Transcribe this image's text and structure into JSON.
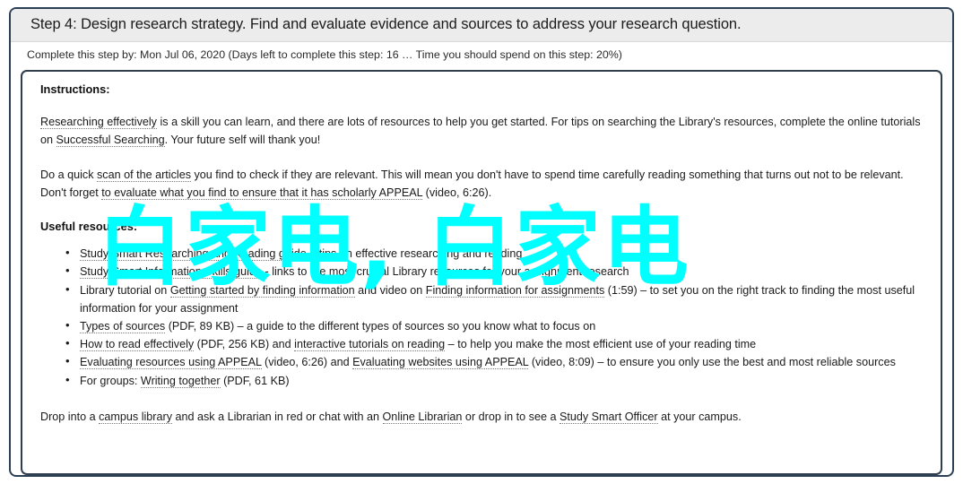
{
  "step": {
    "header": "Step 4: Design research strategy. Find and evaluate evidence and sources to address your research question.",
    "subline": "Complete this step by: Mon Jul 06, 2020 (Days left to complete this step: 16 … Time you should spend on this step: 20%)",
    "due_date": "Mon Jul 06, 2020",
    "days_left": "16",
    "time_percent": "20%"
  },
  "instructions": {
    "title": "Instructions:",
    "para1_a": "Researching effectively",
    "para1_b": " is a skill you can learn, and there are lots of resources to help you get started. For tips on searching the Library's resources, complete the online tutorials on ",
    "para1_c": "Successful Searching",
    "para1_d": ". Your future self will thank you!",
    "para2_a": "Do a quick ",
    "para2_b": "scan of the articles",
    "para2_c": " you find to check if they are relevant. This will mean you don't have to spend time carefully reading something that turns out not to be relevant. Don't forget ",
    "para2_d": "to evaluate what you find to ensure that it has scholarly APPEAL",
    "para2_e": " (video, 6:26).",
    "resources_title": "Useful resources:"
  },
  "resources": [
    {
      "link": "Study Smart Researching and Reading guide",
      "rest": " – tips on effective researching and reading"
    },
    {
      "link": "Study Smart Information Skills guide",
      "rest": " - links to the most crucial Library resources for your assignment research"
    },
    {
      "prefix": "Library tutorial on ",
      "link": "Getting started by finding information",
      "mid": " and video on ",
      "link2": "Finding information for assignments",
      "rest": " (1:59) – to set you on the right track to finding the most useful information for your assignment"
    },
    {
      "link": "Types of sources",
      "rest": " (PDF, 89 KB) – a guide to the different types of sources so you know what to focus on"
    },
    {
      "link": "How to read effectively",
      "mid": " (PDF, 256 KB) and ",
      "link2": "interactive tutorials on reading",
      "rest": " – to help you make the most efficient use of your reading time"
    },
    {
      "link": "Evaluating resources using APPEAL",
      "mid": " (video, 6:26) and ",
      "link2": "Evaluating websites using APPEAL",
      "rest": " (video, 8:09) – to ensure you only use the best and most reliable sources"
    },
    {
      "prefix": "For groups: ",
      "link": "Writing together",
      "rest": " (PDF, 61 KB)"
    }
  ],
  "footer": {
    "a": "Drop into a ",
    "b": "campus library",
    "c": " and ask a Librarian in red or chat with an ",
    "d": "Online Librarian",
    "e": " or drop in to see a ",
    "f": "Study Smart Officer",
    "g": " at your campus."
  },
  "watermark": {
    "text": "白家电, 白家电",
    "color": "#00ffff"
  },
  "colors": {
    "panel_border": "#2c4055",
    "header_bg": "#ececec",
    "inner_border": "#303d4c",
    "accent_cyan": "#00ffff"
  }
}
